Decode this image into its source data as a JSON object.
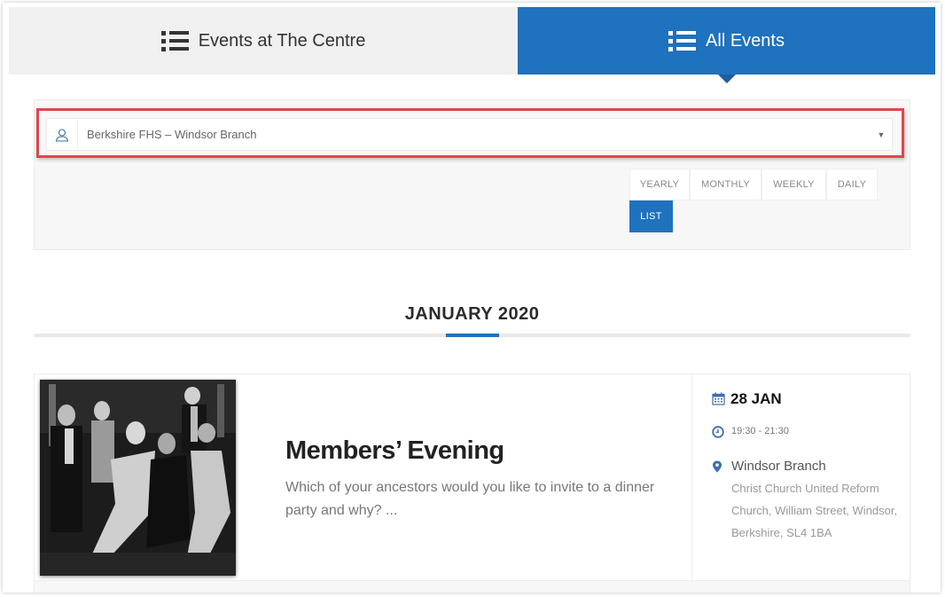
{
  "tabs": [
    {
      "label": "Events at The Centre",
      "icon": "list-icon",
      "active": false
    },
    {
      "label": "All Events",
      "icon": "list-icon",
      "active": true
    }
  ],
  "filter": {
    "icon": "user-icon",
    "selected_value": "Berkshire FHS – Windsor Branch",
    "arrow": "▼"
  },
  "views": {
    "yearly": "YEARLY",
    "monthly": "MONTHLY",
    "weekly": "WEEKLY",
    "daily": "DAILY",
    "list": "LIST",
    "active": "LIST"
  },
  "month_header": "JANUARY 2020",
  "event": {
    "title": "Members’ Evening",
    "description": "Which of your ancestors would you like to invite to a dinner party and why? ...",
    "date": "28 JAN",
    "time": "19:30 - 21:30",
    "venue": "Windsor Branch",
    "address": "Christ Church United Reform Church, William Street, Windsor, Berkshire, SL4 1BA",
    "image_alt": "Vintage black-and-white photo of a dinner party"
  },
  "colors": {
    "accent": "#1f72bd",
    "highlight": "#e0474c"
  }
}
